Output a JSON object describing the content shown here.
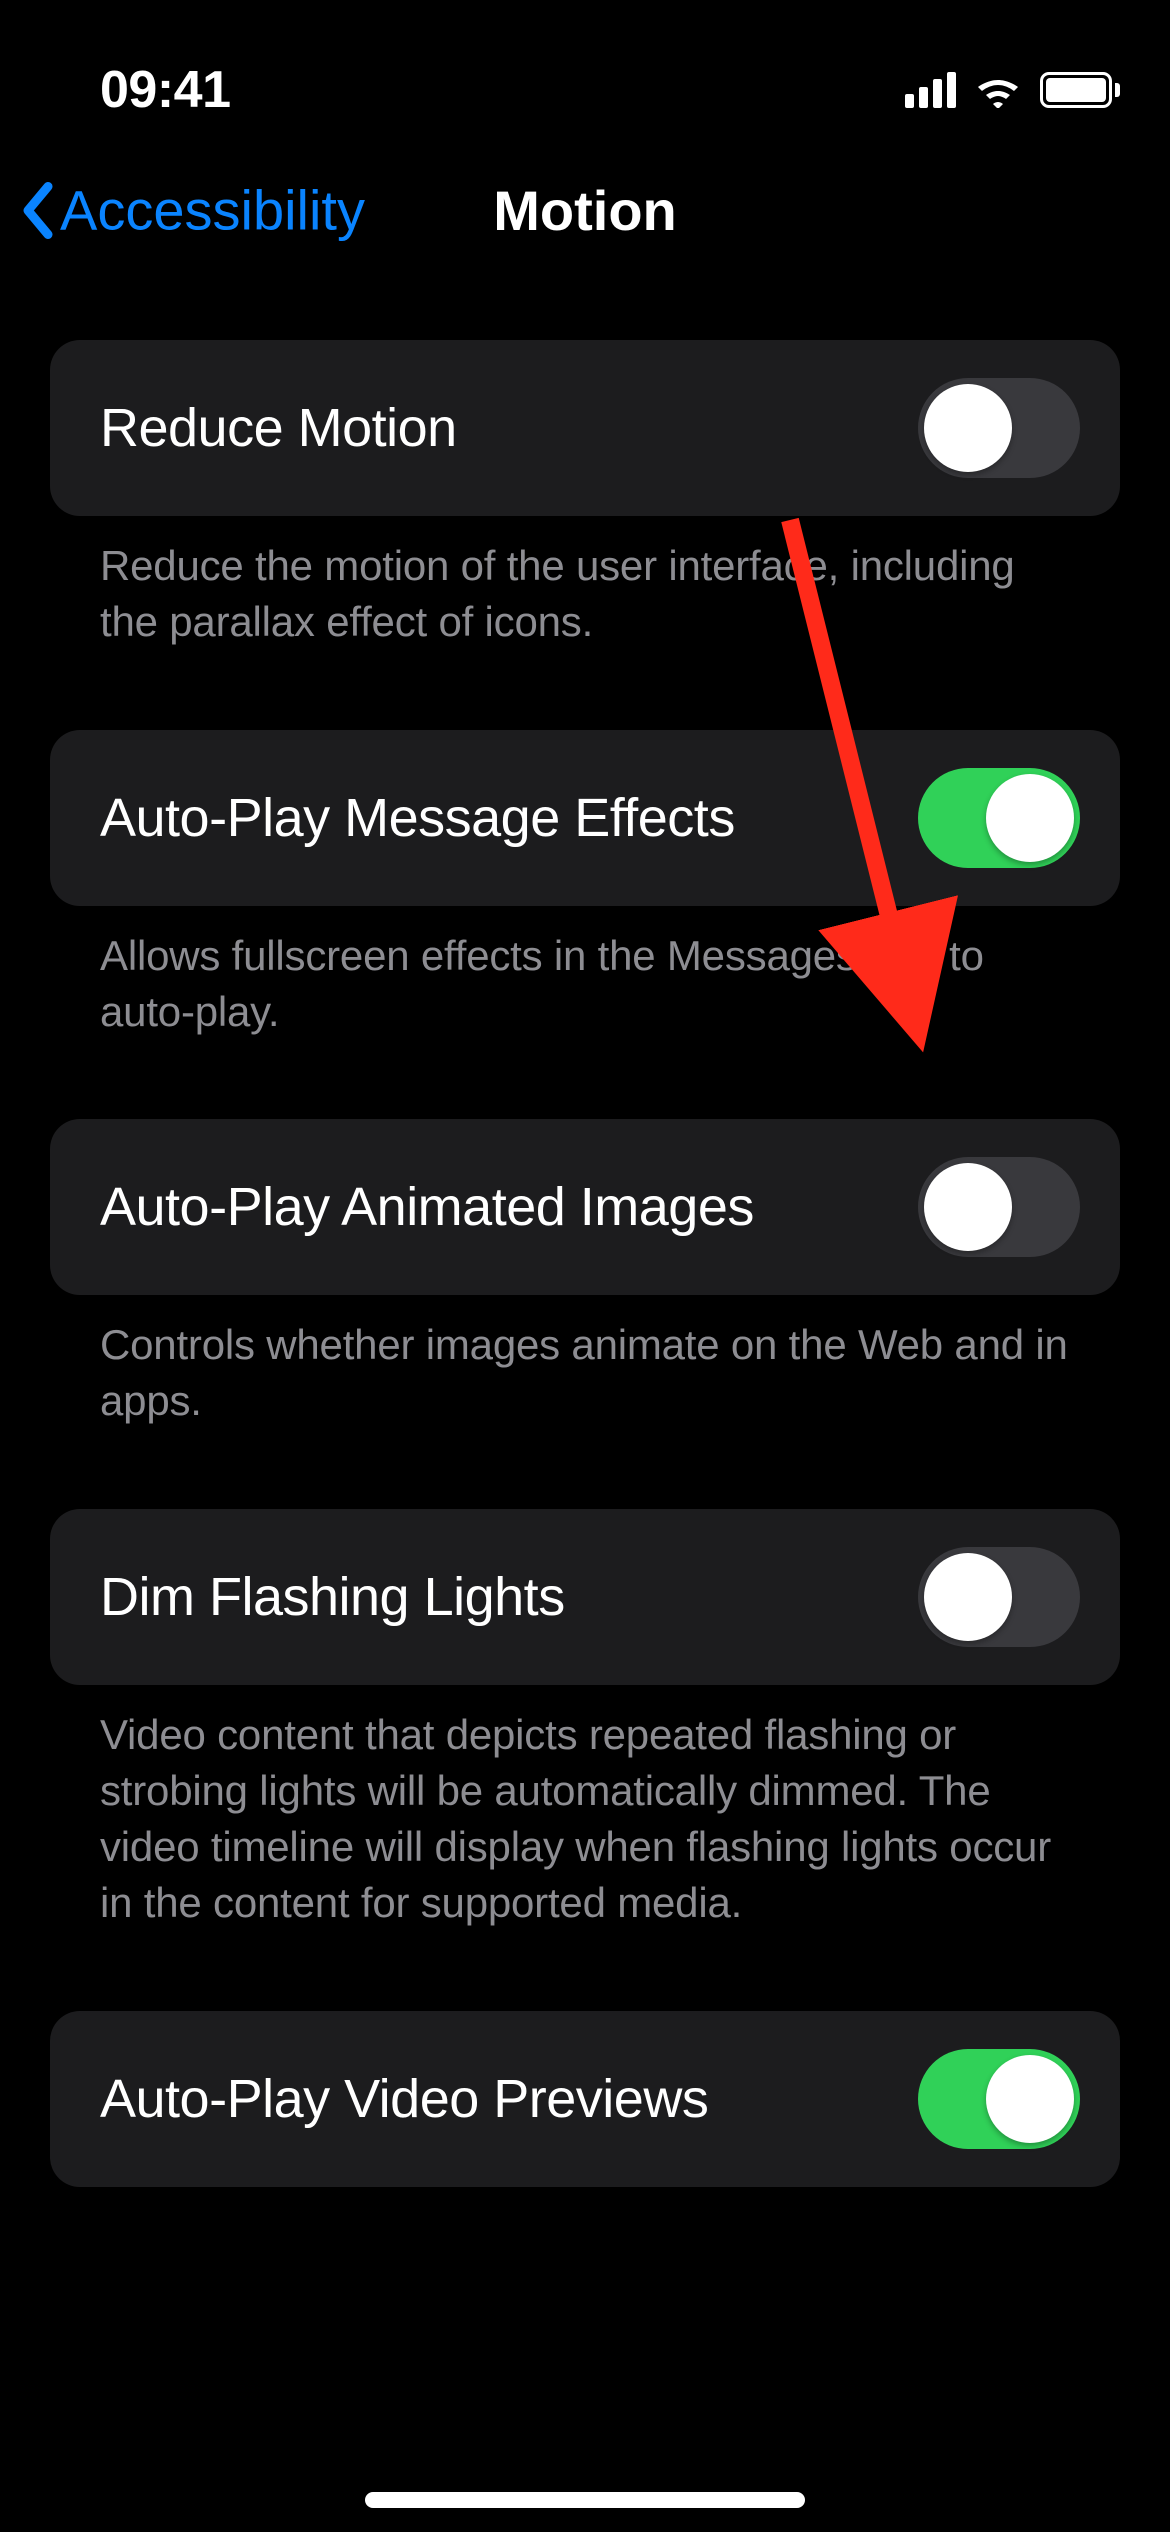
{
  "status": {
    "time": "09:41"
  },
  "nav": {
    "back_label": "Accessibility",
    "title": "Motion"
  },
  "rows": {
    "reduce_motion": {
      "label": "Reduce Motion",
      "footer": "Reduce the motion of the user interface, including the parallax effect of icons.",
      "on": false
    },
    "auto_play_message_effects": {
      "label": "Auto-Play Message Effects",
      "footer": "Allows fullscreen effects in the Messages app to auto-play.",
      "on": true
    },
    "auto_play_animated_images": {
      "label": "Auto-Play Animated Images",
      "footer": "Controls whether images animate on the Web and in apps.",
      "on": false
    },
    "dim_flashing_lights": {
      "label": "Dim Flashing Lights",
      "footer": "Video content that depicts repeated flashing or strobing lights will be automatically dimmed. The video timeline will display when flashing lights occur in the content for supported media.",
      "on": false
    },
    "auto_play_video_previews": {
      "label": "Auto-Play Video Previews",
      "on": true
    }
  }
}
